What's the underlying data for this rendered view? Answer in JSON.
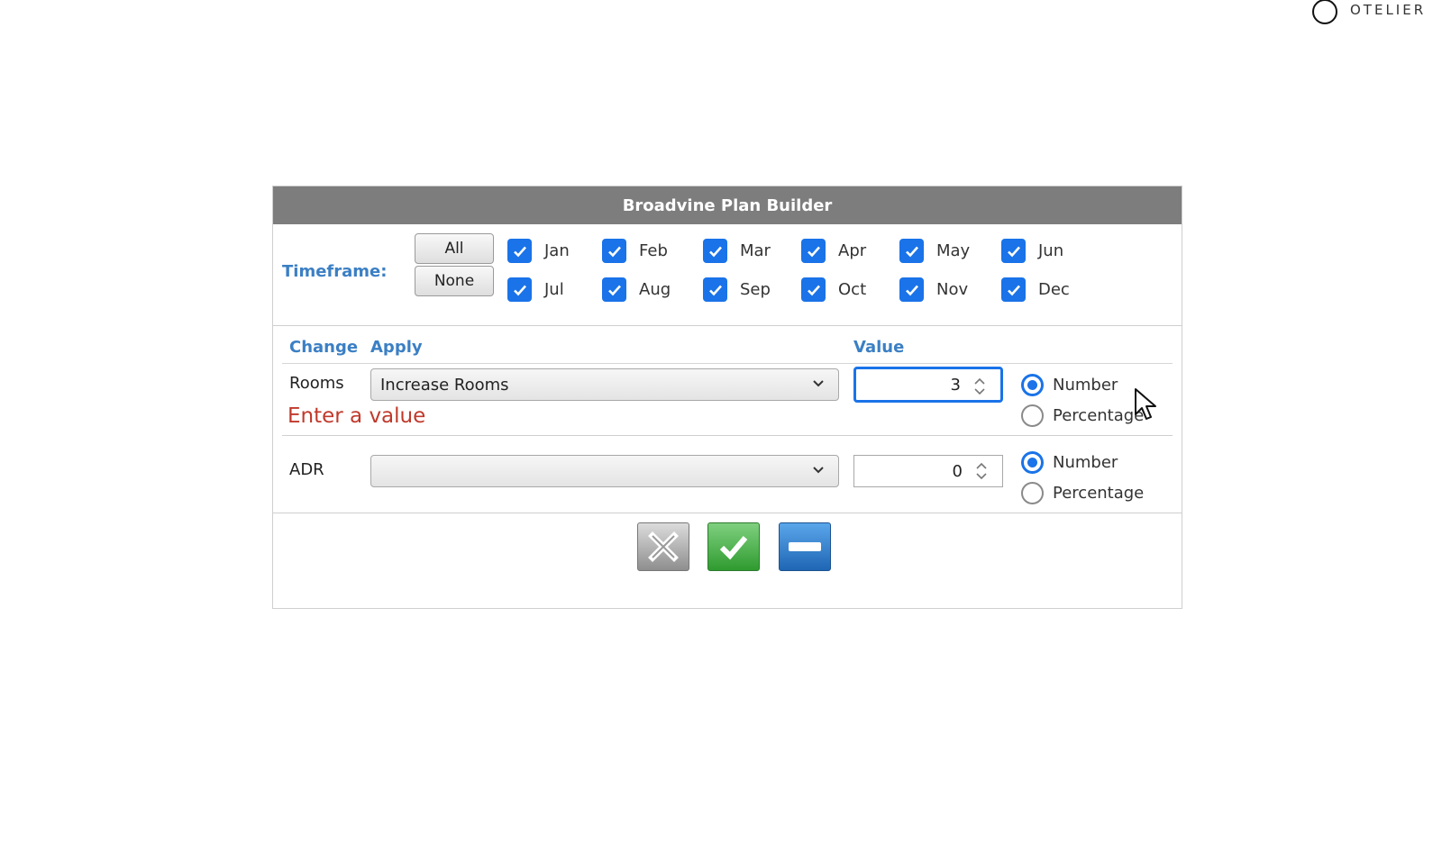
{
  "brand": {
    "name": "OTELIER"
  },
  "dialog": {
    "title": "Broadvine Plan Builder",
    "timeframe": {
      "label": "Timeframe:",
      "all_button": "All",
      "none_button": "None",
      "months": [
        {
          "label": "Jan",
          "checked": true
        },
        {
          "label": "Feb",
          "checked": true
        },
        {
          "label": "Mar",
          "checked": true
        },
        {
          "label": "Apr",
          "checked": true
        },
        {
          "label": "May",
          "checked": true
        },
        {
          "label": "Jun",
          "checked": true
        },
        {
          "label": "Jul",
          "checked": true
        },
        {
          "label": "Aug",
          "checked": true
        },
        {
          "label": "Sep",
          "checked": true
        },
        {
          "label": "Oct",
          "checked": true
        },
        {
          "label": "Nov",
          "checked": true
        },
        {
          "label": "Dec",
          "checked": true
        }
      ]
    },
    "headers": {
      "change": "Change",
      "apply": "Apply",
      "value": "Value"
    },
    "rows": [
      {
        "label": "Rooms",
        "apply": "Increase Rooms",
        "value": "3",
        "mode": "Number",
        "option_number": "Number",
        "option_percentage": "Percentage",
        "error": "Enter a value"
      },
      {
        "label": "ADR",
        "apply": "",
        "value": "0",
        "mode": "Number",
        "option_number": "Number",
        "option_percentage": "Percentage"
      }
    ],
    "actions": {
      "cancel": "cancel-icon",
      "confirm": "check-icon",
      "remove": "minus-icon"
    },
    "colors": {
      "accent": "#1a73e8",
      "header_text": "#3b7fc4",
      "title_bar": "#7d7d7d",
      "error": "#c0392b"
    }
  }
}
